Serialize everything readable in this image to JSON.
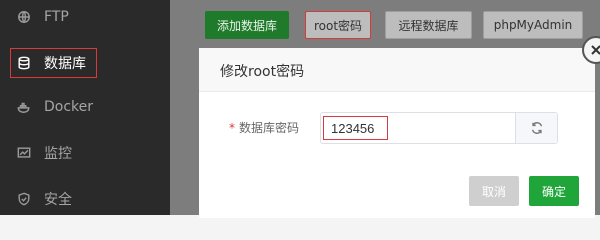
{
  "sidebar": {
    "items": [
      {
        "label": "FTP",
        "icon": "ftp-icon"
      },
      {
        "label": "数据库",
        "icon": "database-icon"
      },
      {
        "label": "Docker",
        "icon": "docker-icon"
      },
      {
        "label": "监控",
        "icon": "monitor-icon"
      },
      {
        "label": "安全",
        "icon": "shield-icon"
      }
    ],
    "active": "数据库"
  },
  "toolbar": {
    "add_db": "添加数据库",
    "root_pwd": "root密码",
    "remote_db": "远程数据库",
    "phpmyadmin": "phpMyAdmin"
  },
  "dialog": {
    "title": "修改root密码",
    "required_mark": "*",
    "password_label": "数据库密码",
    "password_value": "123456",
    "cancel_label": "取消",
    "confirm_label": "确定"
  },
  "colors": {
    "accent_green": "#20a53a",
    "highlight_red": "#d83a3a",
    "sidebar_bg": "#2a2a2a"
  }
}
